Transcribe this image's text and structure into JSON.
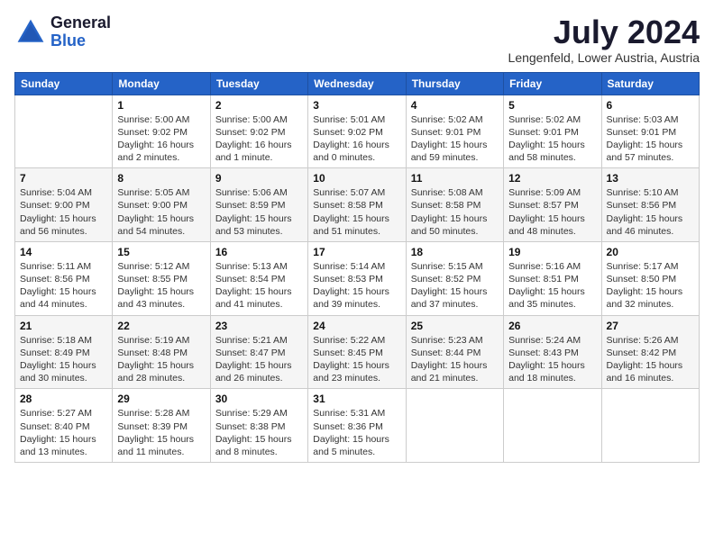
{
  "header": {
    "logo_general": "General",
    "logo_blue": "Blue",
    "month_year": "July 2024",
    "location": "Lengenfeld, Lower Austria, Austria"
  },
  "days_of_week": [
    "Sunday",
    "Monday",
    "Tuesday",
    "Wednesday",
    "Thursday",
    "Friday",
    "Saturday"
  ],
  "weeks": [
    [
      {
        "day": "",
        "sunrise": "",
        "sunset": "",
        "daylight": ""
      },
      {
        "day": "1",
        "sunrise": "Sunrise: 5:00 AM",
        "sunset": "Sunset: 9:02 PM",
        "daylight": "Daylight: 16 hours and 2 minutes."
      },
      {
        "day": "2",
        "sunrise": "Sunrise: 5:00 AM",
        "sunset": "Sunset: 9:02 PM",
        "daylight": "Daylight: 16 hours and 1 minute."
      },
      {
        "day": "3",
        "sunrise": "Sunrise: 5:01 AM",
        "sunset": "Sunset: 9:02 PM",
        "daylight": "Daylight: 16 hours and 0 minutes."
      },
      {
        "day": "4",
        "sunrise": "Sunrise: 5:02 AM",
        "sunset": "Sunset: 9:01 PM",
        "daylight": "Daylight: 15 hours and 59 minutes."
      },
      {
        "day": "5",
        "sunrise": "Sunrise: 5:02 AM",
        "sunset": "Sunset: 9:01 PM",
        "daylight": "Daylight: 15 hours and 58 minutes."
      },
      {
        "day": "6",
        "sunrise": "Sunrise: 5:03 AM",
        "sunset": "Sunset: 9:01 PM",
        "daylight": "Daylight: 15 hours and 57 minutes."
      }
    ],
    [
      {
        "day": "7",
        "sunrise": "Sunrise: 5:04 AM",
        "sunset": "Sunset: 9:00 PM",
        "daylight": "Daylight: 15 hours and 56 minutes."
      },
      {
        "day": "8",
        "sunrise": "Sunrise: 5:05 AM",
        "sunset": "Sunset: 9:00 PM",
        "daylight": "Daylight: 15 hours and 54 minutes."
      },
      {
        "day": "9",
        "sunrise": "Sunrise: 5:06 AM",
        "sunset": "Sunset: 8:59 PM",
        "daylight": "Daylight: 15 hours and 53 minutes."
      },
      {
        "day": "10",
        "sunrise": "Sunrise: 5:07 AM",
        "sunset": "Sunset: 8:58 PM",
        "daylight": "Daylight: 15 hours and 51 minutes."
      },
      {
        "day": "11",
        "sunrise": "Sunrise: 5:08 AM",
        "sunset": "Sunset: 8:58 PM",
        "daylight": "Daylight: 15 hours and 50 minutes."
      },
      {
        "day": "12",
        "sunrise": "Sunrise: 5:09 AM",
        "sunset": "Sunset: 8:57 PM",
        "daylight": "Daylight: 15 hours and 48 minutes."
      },
      {
        "day": "13",
        "sunrise": "Sunrise: 5:10 AM",
        "sunset": "Sunset: 8:56 PM",
        "daylight": "Daylight: 15 hours and 46 minutes."
      }
    ],
    [
      {
        "day": "14",
        "sunrise": "Sunrise: 5:11 AM",
        "sunset": "Sunset: 8:56 PM",
        "daylight": "Daylight: 15 hours and 44 minutes."
      },
      {
        "day": "15",
        "sunrise": "Sunrise: 5:12 AM",
        "sunset": "Sunset: 8:55 PM",
        "daylight": "Daylight: 15 hours and 43 minutes."
      },
      {
        "day": "16",
        "sunrise": "Sunrise: 5:13 AM",
        "sunset": "Sunset: 8:54 PM",
        "daylight": "Daylight: 15 hours and 41 minutes."
      },
      {
        "day": "17",
        "sunrise": "Sunrise: 5:14 AM",
        "sunset": "Sunset: 8:53 PM",
        "daylight": "Daylight: 15 hours and 39 minutes."
      },
      {
        "day": "18",
        "sunrise": "Sunrise: 5:15 AM",
        "sunset": "Sunset: 8:52 PM",
        "daylight": "Daylight: 15 hours and 37 minutes."
      },
      {
        "day": "19",
        "sunrise": "Sunrise: 5:16 AM",
        "sunset": "Sunset: 8:51 PM",
        "daylight": "Daylight: 15 hours and 35 minutes."
      },
      {
        "day": "20",
        "sunrise": "Sunrise: 5:17 AM",
        "sunset": "Sunset: 8:50 PM",
        "daylight": "Daylight: 15 hours and 32 minutes."
      }
    ],
    [
      {
        "day": "21",
        "sunrise": "Sunrise: 5:18 AM",
        "sunset": "Sunset: 8:49 PM",
        "daylight": "Daylight: 15 hours and 30 minutes."
      },
      {
        "day": "22",
        "sunrise": "Sunrise: 5:19 AM",
        "sunset": "Sunset: 8:48 PM",
        "daylight": "Daylight: 15 hours and 28 minutes."
      },
      {
        "day": "23",
        "sunrise": "Sunrise: 5:21 AM",
        "sunset": "Sunset: 8:47 PM",
        "daylight": "Daylight: 15 hours and 26 minutes."
      },
      {
        "day": "24",
        "sunrise": "Sunrise: 5:22 AM",
        "sunset": "Sunset: 8:45 PM",
        "daylight": "Daylight: 15 hours and 23 minutes."
      },
      {
        "day": "25",
        "sunrise": "Sunrise: 5:23 AM",
        "sunset": "Sunset: 8:44 PM",
        "daylight": "Daylight: 15 hours and 21 minutes."
      },
      {
        "day": "26",
        "sunrise": "Sunrise: 5:24 AM",
        "sunset": "Sunset: 8:43 PM",
        "daylight": "Daylight: 15 hours and 18 minutes."
      },
      {
        "day": "27",
        "sunrise": "Sunrise: 5:26 AM",
        "sunset": "Sunset: 8:42 PM",
        "daylight": "Daylight: 15 hours and 16 minutes."
      }
    ],
    [
      {
        "day": "28",
        "sunrise": "Sunrise: 5:27 AM",
        "sunset": "Sunset: 8:40 PM",
        "daylight": "Daylight: 15 hours and 13 minutes."
      },
      {
        "day": "29",
        "sunrise": "Sunrise: 5:28 AM",
        "sunset": "Sunset: 8:39 PM",
        "daylight": "Daylight: 15 hours and 11 minutes."
      },
      {
        "day": "30",
        "sunrise": "Sunrise: 5:29 AM",
        "sunset": "Sunset: 8:38 PM",
        "daylight": "Daylight: 15 hours and 8 minutes."
      },
      {
        "day": "31",
        "sunrise": "Sunrise: 5:31 AM",
        "sunset": "Sunset: 8:36 PM",
        "daylight": "Daylight: 15 hours and 5 minutes."
      },
      {
        "day": "",
        "sunrise": "",
        "sunset": "",
        "daylight": ""
      },
      {
        "day": "",
        "sunrise": "",
        "sunset": "",
        "daylight": ""
      },
      {
        "day": "",
        "sunrise": "",
        "sunset": "",
        "daylight": ""
      }
    ]
  ]
}
